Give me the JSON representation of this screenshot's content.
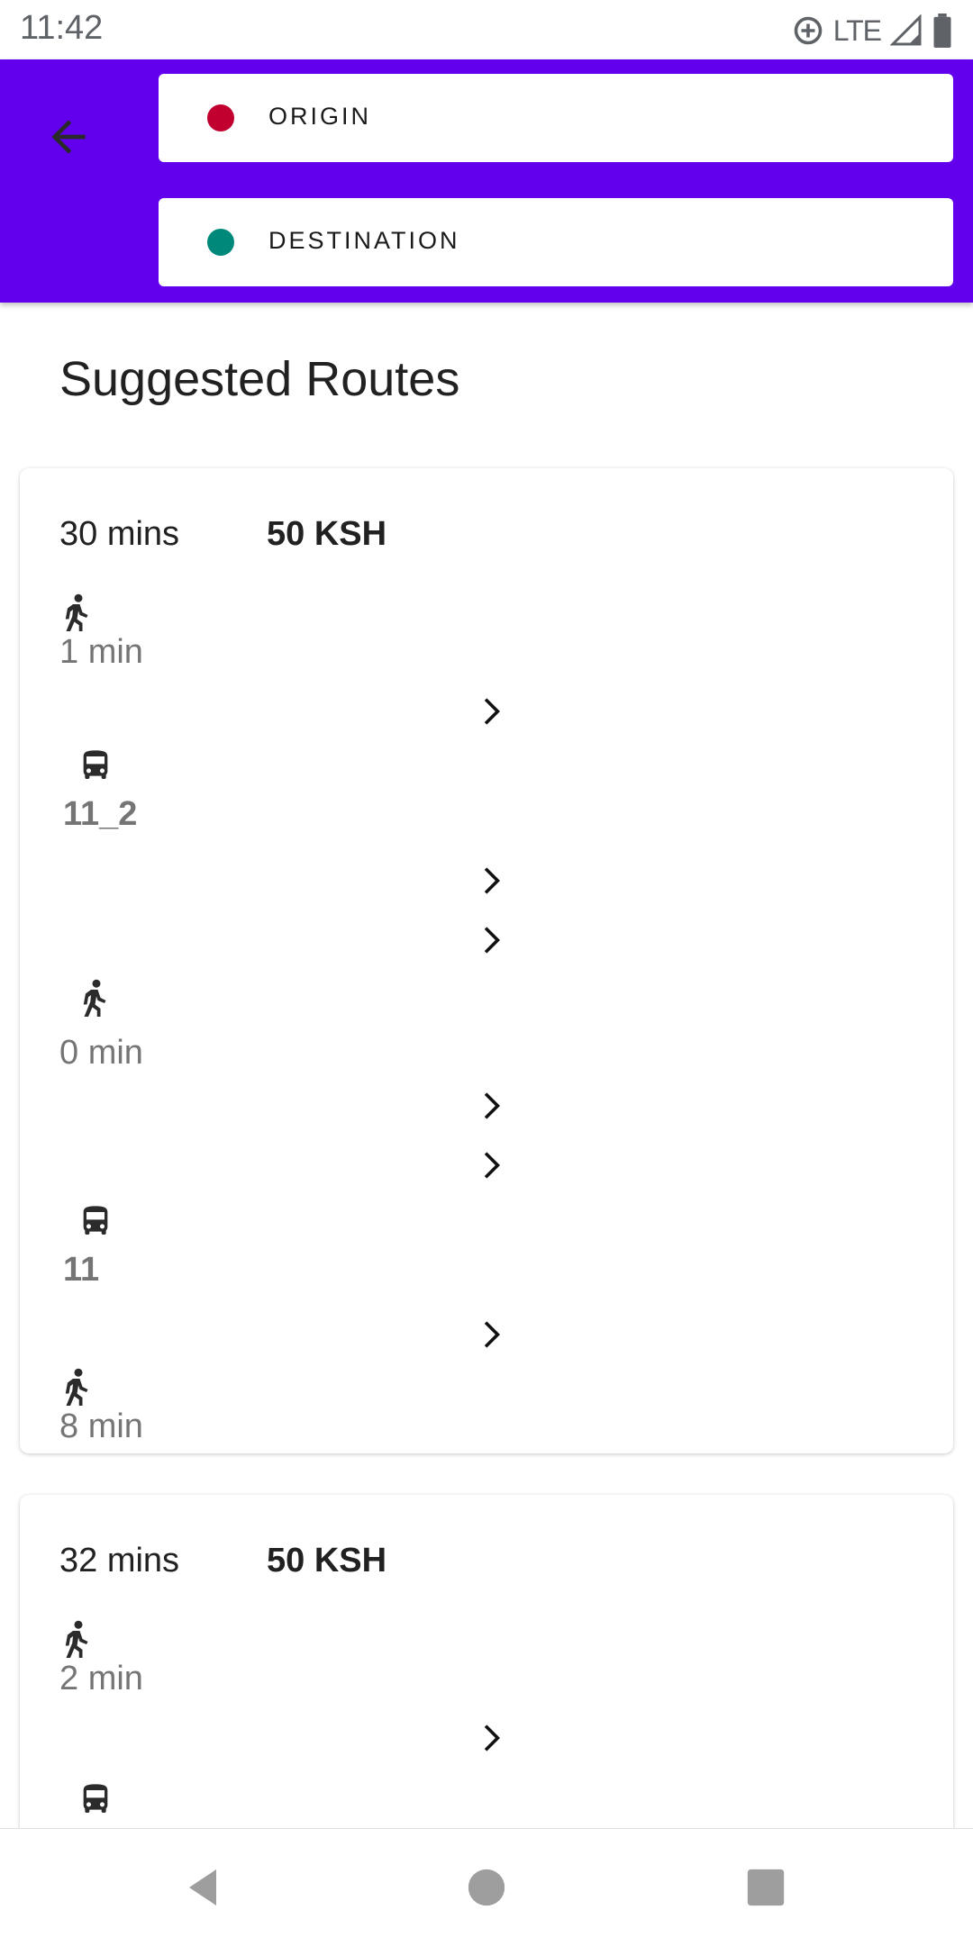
{
  "status_bar": {
    "time": "11:42",
    "network": "LTE"
  },
  "header": {
    "origin_label": "ORIGIN",
    "destination_label": "DESTINATION",
    "origin_color": "#c2002f",
    "destination_color": "#00897b",
    "background_color": "#6200ee"
  },
  "heading": "Suggested Routes",
  "routes": [
    {
      "duration": "30 mins",
      "price": "50 KSH",
      "steps": [
        {
          "type": "walk",
          "text": "1 min"
        },
        {
          "type": "bus",
          "text": "11_2"
        },
        {
          "type": "walk",
          "text": "0 min"
        },
        {
          "type": "bus",
          "text": "11"
        },
        {
          "type": "walk",
          "text": "8 min"
        }
      ]
    },
    {
      "duration": "32 mins",
      "price": "50 KSH",
      "steps": [
        {
          "type": "walk",
          "text": "2 min"
        },
        {
          "type": "bus",
          "text": ""
        }
      ]
    }
  ],
  "icons": {
    "back": "arrow-back-icon",
    "walk": "directions-walk-icon",
    "bus": "directions-bus-icon",
    "chevron": "chevron-right-icon"
  }
}
